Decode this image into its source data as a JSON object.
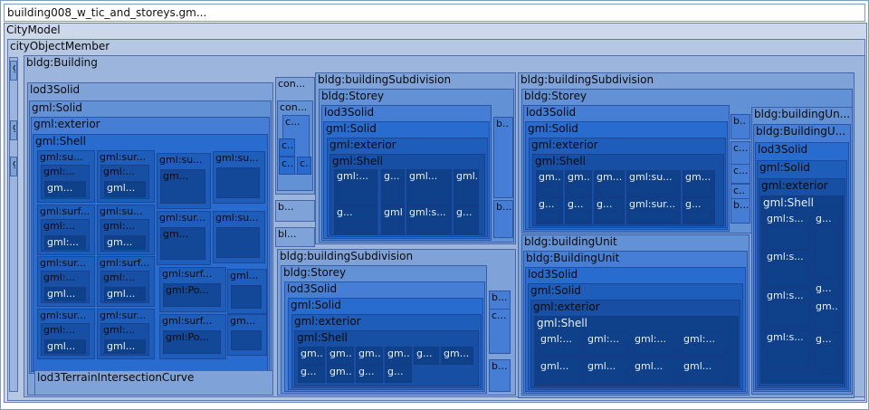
{
  "title": "building008_w_tic_and_storeys.gm...",
  "root": "CityModel",
  "member": "cityObjectMember",
  "building": "bldg:Building",
  "side": [
    "g.",
    "g.",
    "g"
  ],
  "main": {
    "lod3solid": "lod3Solid",
    "solid": "gml:Solid",
    "exterior": "gml:exterior",
    "shell": "gml:Shell",
    "cells": [
      [
        "gml:su...",
        "gml:...",
        "gm..."
      ],
      [
        "gml:sur...",
        "gml:...",
        "gml..."
      ],
      [
        "gml:surf...",
        "gml:...",
        "gml:..."
      ],
      [
        "gml:su...",
        "gml:...",
        "gm..."
      ],
      [
        "gml:sur...",
        "gml:...",
        "gml..."
      ],
      [
        "gml:surf...",
        "gml:...",
        "gml..."
      ],
      [
        "gml:sur...",
        "gml:...",
        "gml..."
      ],
      [
        "gml:sur...",
        "gml:...",
        "gml..."
      ],
      [
        "gml:sur...",
        "gml:...",
        "gml..."
      ],
      [
        "gml:sur...",
        "gml:...",
        "gml..."
      ]
    ],
    "col3": [
      [
        "gml:su...",
        "gm..."
      ],
      [
        "gml:sur...",
        "gm..."
      ],
      [
        "gml:surf...",
        "gml:Po..."
      ],
      [
        "gml:surf...",
        "gml:Po..."
      ]
    ],
    "col4": [
      "gml:su...",
      "gml:su...",
      "gml...",
      "gm..."
    ],
    "curve": "lod3TerrainIntersectionCurve"
  },
  "mid": [
    "con...",
    "con...",
    "c...",
    "c...",
    "c...",
    "c...",
    "b...",
    "bl..."
  ],
  "sub1": {
    "title": "bldg:buildingSubdivision",
    "storey": "bldg:Storey",
    "lod3solid": "lod3Solid",
    "solid": "gml:Solid",
    "exterior": "gml:exterior",
    "shell": "gml:Shell",
    "cells": [
      "gml:...",
      "g...",
      "gml...",
      "gml...",
      "g...",
      "gml...",
      "gml:s...",
      "g..."
    ],
    "side": [
      "b..",
      "b..."
    ]
  },
  "sub2": {
    "title": "bldg:buildingSubdivision",
    "storey": "bldg:Storey",
    "lod3solid": "lod3Solid",
    "solid": "gml:Solid",
    "exterior": "gml:exterior",
    "shell": "gml:Shell",
    "cells": [
      "gm...",
      "gm...",
      "gm...",
      "gml:su...",
      "gm...",
      "g...",
      "g...",
      "g...",
      "gml:sur...",
      "g..."
    ],
    "side": [
      "b..",
      "c...",
      "c...",
      "c..",
      "b..."
    ]
  },
  "sub3": {
    "title": "bldg:buildingSubdivision",
    "storey": "bldg:Storey",
    "lod3solid": "lod3Solid",
    "solid": "gml:Solid",
    "exterior": "gml:exterior",
    "shell": "gml:Shell",
    "cells": [
      "gm...",
      "gm...",
      "gm...",
      "gm...",
      "g...",
      "gm...",
      "g...",
      "gm...",
      "g...",
      "g..."
    ],
    "side": [
      "b...",
      "c...",
      "b..."
    ]
  },
  "unit": {
    "title": "bldg:buildingUnit",
    "inner": "bldg:BuildingUnit",
    "lod3solid": "lod3Solid",
    "solid": "gml:Solid",
    "exterior": "gml:exterior",
    "shell": "gml:Shell",
    "cells": [
      "gml:...",
      "gml:...",
      "gml:...",
      "gml:...",
      "gml...",
      "gml...",
      "gml...",
      "gml..."
    ]
  },
  "unit2": {
    "title": "bldg:buildingUn...",
    "inner": "bldg:BuildingU...",
    "lod3solid": "lod3Solid",
    "solid": "gml:Solid",
    "exterior": "gml:exterior",
    "shell": "gml:Shell",
    "cells": [
      "gml:s...",
      "g...",
      "gml:s...",
      "g...",
      "gml:s...",
      "gm...",
      "gml:s...",
      "g..."
    ]
  }
}
